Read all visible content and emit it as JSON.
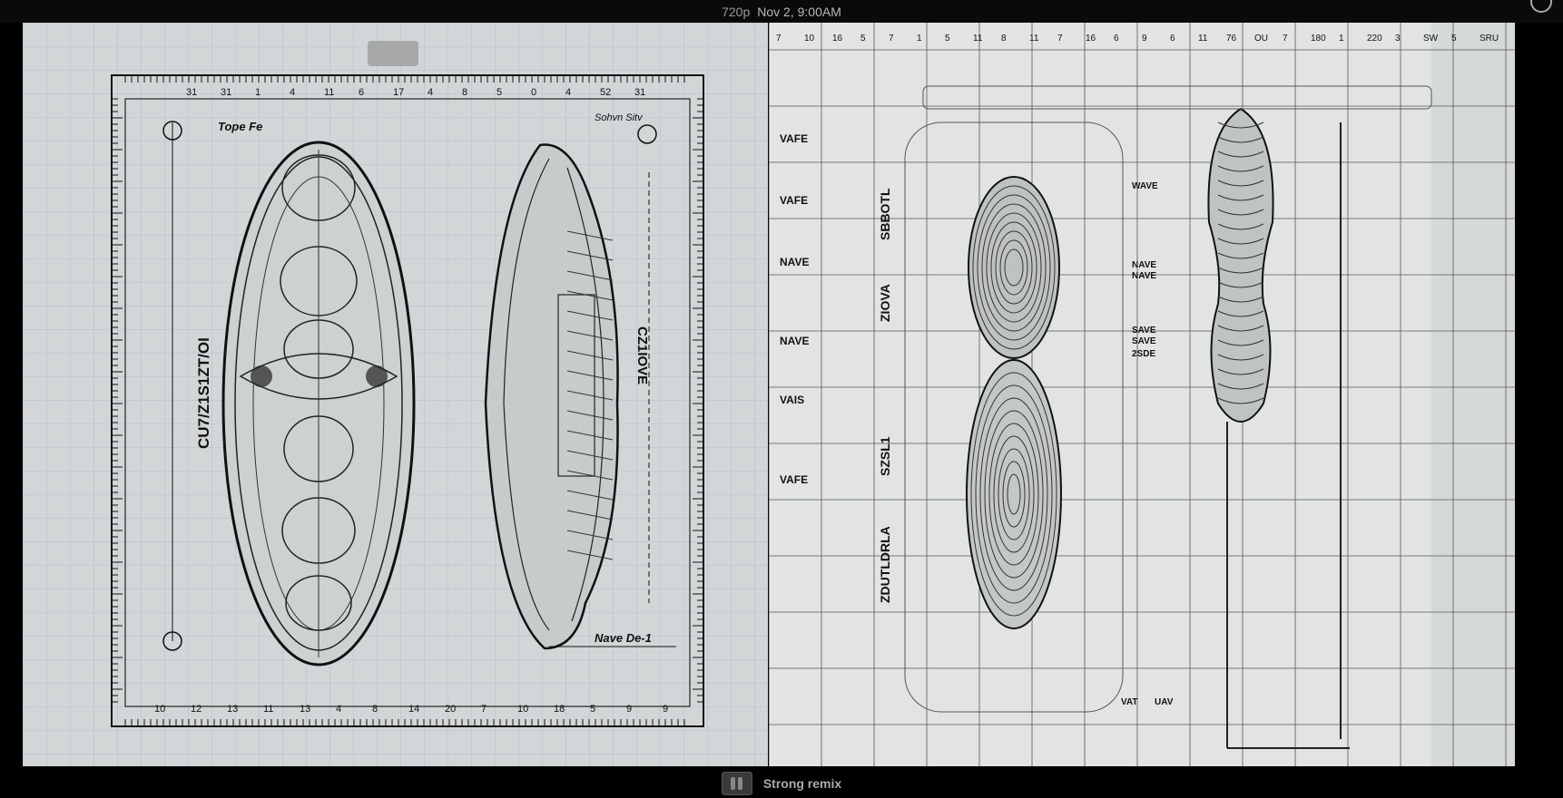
{
  "topbar": {
    "resolution": "720p",
    "timestamp": "Nov 2, 9:00AM"
  },
  "left_image": {
    "label_top": "Tope Fe",
    "label_side_top": "Sohvn Sitv",
    "label_bottom_right": "Nave De-1",
    "vertical_left": "CU7/Z1S1ZT/OI",
    "vertical_right": "CZ1IOVE",
    "top_scale": [
      "31",
      "31",
      "1",
      "4",
      "11",
      "6",
      "17",
      "4",
      "8",
      "5",
      "0",
      "4",
      "52",
      "31"
    ],
    "bottom_scale": [
      "10",
      "12",
      "13",
      "11",
      "13",
      "4",
      "8",
      "14",
      "20",
      "7",
      "10",
      "18",
      "5",
      "9",
      "9"
    ]
  },
  "right_image": {
    "row_labels": [
      "VAFE",
      "VAFE",
      "NAVE",
      "NAVE",
      "VAIS",
      "VAFE"
    ],
    "vertical_labels": [
      "SBBOTL",
      "ZIOVA",
      "SZSL1",
      "ZDUTLDRLA"
    ],
    "callouts": [
      "NAVE",
      "NAVE",
      "SAVE",
      "SAVE",
      "2SDE",
      "WAVE",
      "VAT",
      "UAV"
    ],
    "top_numbers": [
      "7",
      "10",
      "16",
      "5",
      "7",
      "1",
      "5",
      "11",
      "8",
      "11",
      "7",
      "16",
      "6",
      "9",
      "6",
      "11",
      "76",
      "OU",
      "7",
      "180",
      "1",
      "220",
      "3",
      "SW",
      "5",
      "SRU"
    ]
  },
  "bottom": {
    "remix_label": "Strong remix"
  }
}
